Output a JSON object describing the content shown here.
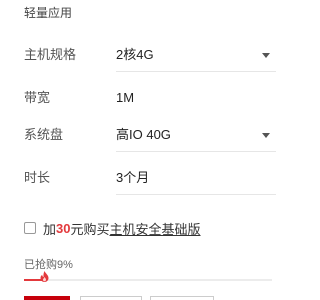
{
  "section": {
    "title": "轻量应用"
  },
  "fields": [
    {
      "label": "主机规格",
      "value": "2核4G"
    },
    {
      "label": "带宽",
      "value": "1M"
    },
    {
      "label": "系统盘",
      "value": "高IO 40G"
    },
    {
      "label": "时长",
      "value": "3个月"
    }
  ],
  "addon": {
    "prefix": "加",
    "price": "30",
    "middle": "元购买",
    "link": "主机安全基础版",
    "checked": false
  },
  "sales": {
    "label": "已抢购9%",
    "progress_fraction": 0.09
  },
  "colors": {
    "accent": "#e3393c",
    "brand": "#c7000b"
  },
  "icons": {
    "select_arrow": "caret-down-icon",
    "progress_marker": "flame-icon"
  }
}
